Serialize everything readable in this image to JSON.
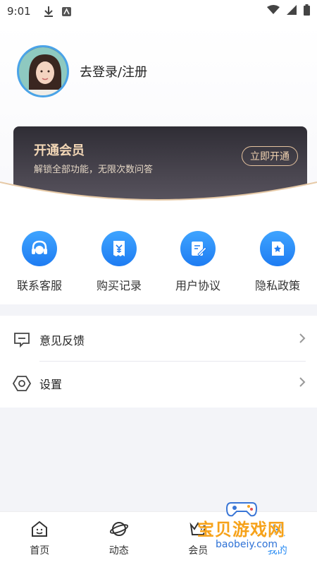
{
  "status_bar": {
    "time": "9:01"
  },
  "profile": {
    "login_text": "去登录/注册"
  },
  "vip": {
    "title": "开通会员",
    "description": "解锁全部功能，无限次数问答",
    "button": "立即开通"
  },
  "shortcuts": [
    {
      "label": "联系客服",
      "icon": "headset-icon"
    },
    {
      "label": "购买记录",
      "icon": "receipt-icon"
    },
    {
      "label": "用户协议",
      "icon": "agreement-icon"
    },
    {
      "label": "隐私政策",
      "icon": "privacy-icon"
    }
  ],
  "menu": [
    {
      "label": "意见反馈",
      "icon": "feedback-icon"
    },
    {
      "label": "设置",
      "icon": "settings-icon"
    }
  ],
  "tabs": [
    {
      "label": "首页",
      "icon": "home-icon"
    },
    {
      "label": "动态",
      "icon": "planet-icon"
    },
    {
      "label": "会员",
      "icon": "crown-icon"
    },
    {
      "label": "我的",
      "icon": "profile-icon",
      "active": true
    }
  ],
  "watermark": {
    "name": "宝贝游戏网",
    "url": "baobeiy.com"
  },
  "colors": {
    "accent": "#2a8cf3",
    "vip_gold": "#f3d7b6",
    "vip_bg": "#2f2d35"
  }
}
